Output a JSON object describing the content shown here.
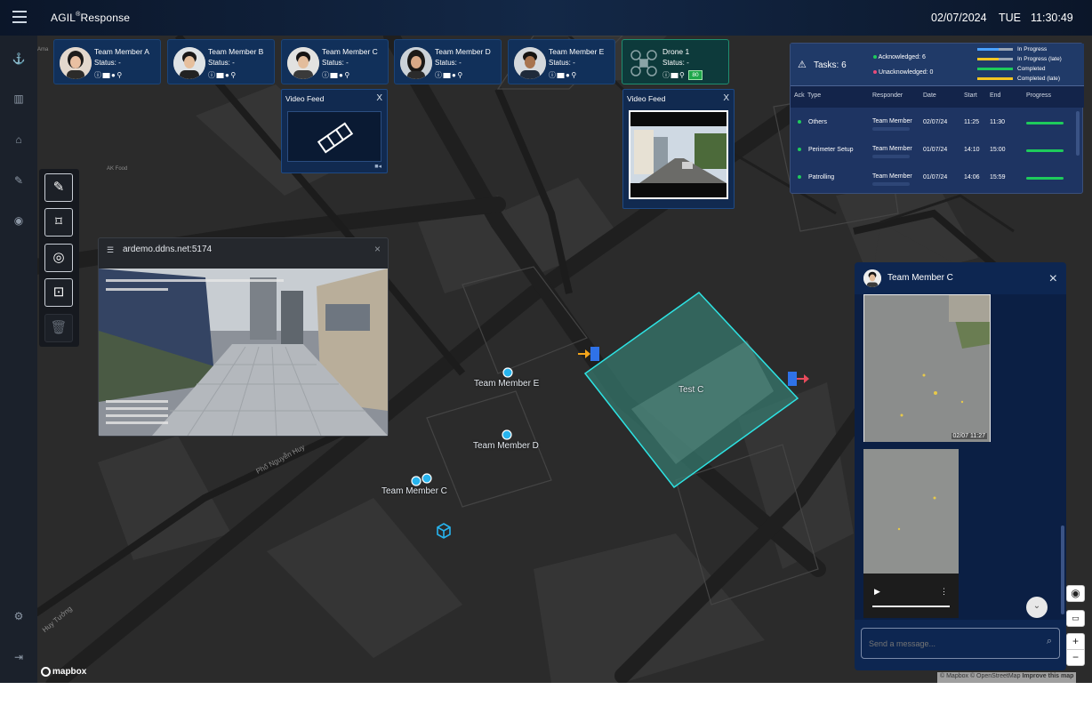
{
  "header": {
    "brand_pre": "AGIL",
    "brand_sup": "®",
    "brand_post": "Response",
    "date": "02/07/2024",
    "day": "TUE",
    "time": "11:30:49"
  },
  "team_members": [
    {
      "name": "Team Member A",
      "status": "Status: -"
    },
    {
      "name": "Team Member B",
      "status": "Status: -"
    },
    {
      "name": "Team Member C",
      "status": "Status: -"
    },
    {
      "name": "Team Member D",
      "status": "Status: -"
    },
    {
      "name": "Team Member E",
      "status": "Status: -"
    }
  ],
  "drone": {
    "name": "Drone 1",
    "status": "Status: -",
    "battery": "80"
  },
  "video_feeds": [
    {
      "title": "Video Feed",
      "close": "X"
    },
    {
      "title": "Video Feed",
      "close": "X"
    }
  ],
  "tasks": {
    "title": "Tasks: 6",
    "acknowledged": "Acknowledged: 6",
    "unacknowledged": "Unacknowledged: 0",
    "legend": [
      "In Progress",
      "In Progress (late)",
      "Completed",
      "Completed (late)"
    ],
    "legend_colors": [
      "#4aa3ff",
      "#f3c623",
      "#1ecb5b",
      "#f3c623"
    ],
    "columns": [
      "Ack",
      "Type",
      "Responder",
      "Date",
      "Start",
      "End",
      "Progress"
    ],
    "rows": [
      {
        "type": "Others",
        "responder": "Team Member",
        "date": "02/07/24",
        "start": "11:25",
        "end": "11:30"
      },
      {
        "type": "Perimeter Setup",
        "responder": "Team Member",
        "date": "01/07/24",
        "start": "14:10",
        "end": "15:00"
      },
      {
        "type": "Patrolling",
        "responder": "Team Member",
        "date": "01/07/24",
        "start": "14:06",
        "end": "15:59"
      }
    ]
  },
  "browser": {
    "url": "ardemo.ddns.net:5174",
    "close": "×"
  },
  "map": {
    "labels": {
      "member_e": "Team Member E",
      "member_d": "Team Member D",
      "member_c": "Team Member C",
      "zone": "Test C",
      "street_1": "Phố Nguyễn Huy",
      "street_2": "Huy Tưởng",
      "poi": "AK Food",
      "poi2": "Ama"
    },
    "logo": "mapbox",
    "attribution_1": "© Mapbox © OpenStreetMap",
    "attribution_2": "Improve this map"
  },
  "chat": {
    "title": "Team Member C",
    "close": "×",
    "timestamp": "02/07 11:27",
    "placeholder": "Send a message..."
  },
  "colors": {
    "accent": "#1b4478",
    "zone": "#2de3e3",
    "marker": "#27b4ee",
    "progress": "#1ecb5b"
  }
}
